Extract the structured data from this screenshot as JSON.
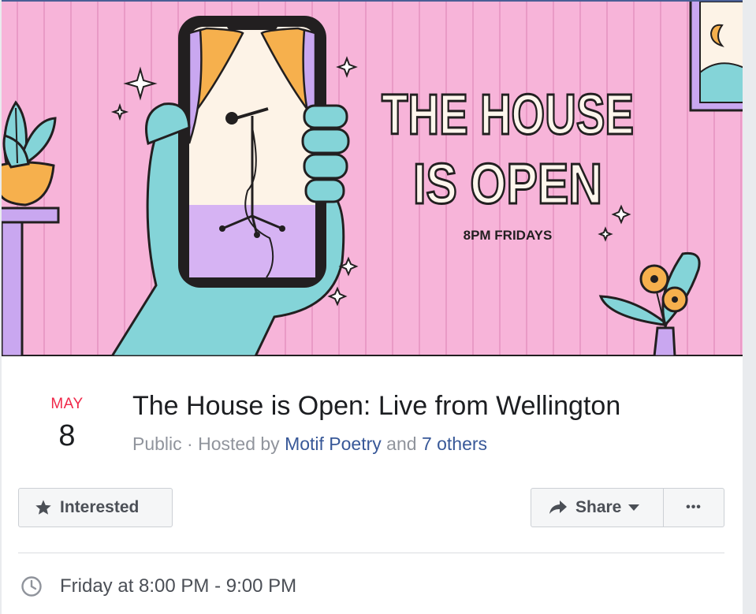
{
  "cover": {
    "headline_line1": "THE HOUSE",
    "headline_line2": "IS OPEN",
    "schedule": "8PM FRIDAYS",
    "colors": {
      "background": "#f7b4d9",
      "stripe": "#e99ac6",
      "hand": "#84d4d8",
      "phone_screen_bottom": "#d6b3f3",
      "curtain": "#f6b04d",
      "outline": "#221f20"
    }
  },
  "event": {
    "month": "MAY",
    "day": "8",
    "title": "The House is Open: Live from Wellington",
    "privacy": "Public",
    "separator": " · ",
    "hosted_by_prefix": "Hosted by ",
    "host": "Motif Poetry",
    "conjunction": " and ",
    "others": "7 others"
  },
  "actions": {
    "interested_label": "Interested",
    "share_label": "Share",
    "more_label": "•••",
    "icons": {
      "interested": "star-icon",
      "share": "share-arrow-icon",
      "share_dropdown": "caret-down-icon",
      "more": "more-dots-icon"
    }
  },
  "details": {
    "time": "Friday at 8:00 PM - 9:00 PM",
    "time_icon": "clock-icon"
  }
}
